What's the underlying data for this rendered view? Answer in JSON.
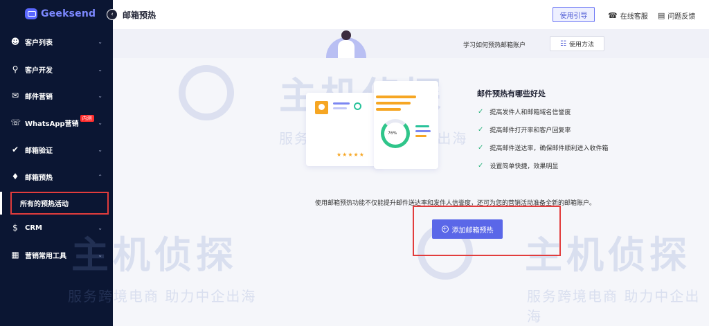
{
  "app": {
    "name": "Geeksend"
  },
  "sidebar": {
    "items": [
      {
        "label": "客户列表",
        "icon": "user-icon",
        "expanded": false
      },
      {
        "label": "客户开发",
        "icon": "search-icon",
        "expanded": false
      },
      {
        "label": "邮件营销",
        "icon": "mail-icon",
        "expanded": false
      },
      {
        "label": "WhatsApp营销",
        "icon": "whatsapp-icon",
        "badge": "内测",
        "expanded": false
      },
      {
        "label": "邮箱验证",
        "icon": "check-circle-icon",
        "expanded": false
      },
      {
        "label": "邮箱预热",
        "icon": "flame-icon",
        "expanded": true
      },
      {
        "label": "CRM",
        "icon": "dollar-circle-icon",
        "expanded": false
      },
      {
        "label": "营销常用工具",
        "icon": "grid-icon",
        "expanded": false
      }
    ],
    "sub_items": {
      "warmup": [
        {
          "label": "所有的预热活动",
          "active": true
        }
      ]
    }
  },
  "header": {
    "title": "邮箱预热",
    "guide_label": "使用引导",
    "support_label": "在线客服",
    "feedback_label": "问题反馈"
  },
  "banner": {
    "text": "学习如何预热邮箱账户",
    "method_label": "使用方法"
  },
  "main": {
    "illustration": {
      "donut_value": "76%"
    },
    "benefits_title": "邮件预热有哪些好处",
    "benefits": [
      "提高发件人和邮箱域名信誉度",
      "提高邮件打开率和客户回复率",
      "提高邮件送达率，确保邮件顺利进入收件箱",
      "设置简单快捷，效果明显"
    ],
    "description": "使用邮箱预热功能不仅能提升邮件送达率和发件人信誉度，还可为您的营销活动准备全新的邮箱账户。",
    "add_label": "添加邮箱预热"
  },
  "watermark": {
    "brand": "主机侦探",
    "slogan": "服务跨境电商 助力中企出海"
  },
  "colors": {
    "sidebar_bg": "#0b1633",
    "accent": "#5a67e8",
    "highlight": "#e23c3c",
    "success": "#29b37c"
  }
}
